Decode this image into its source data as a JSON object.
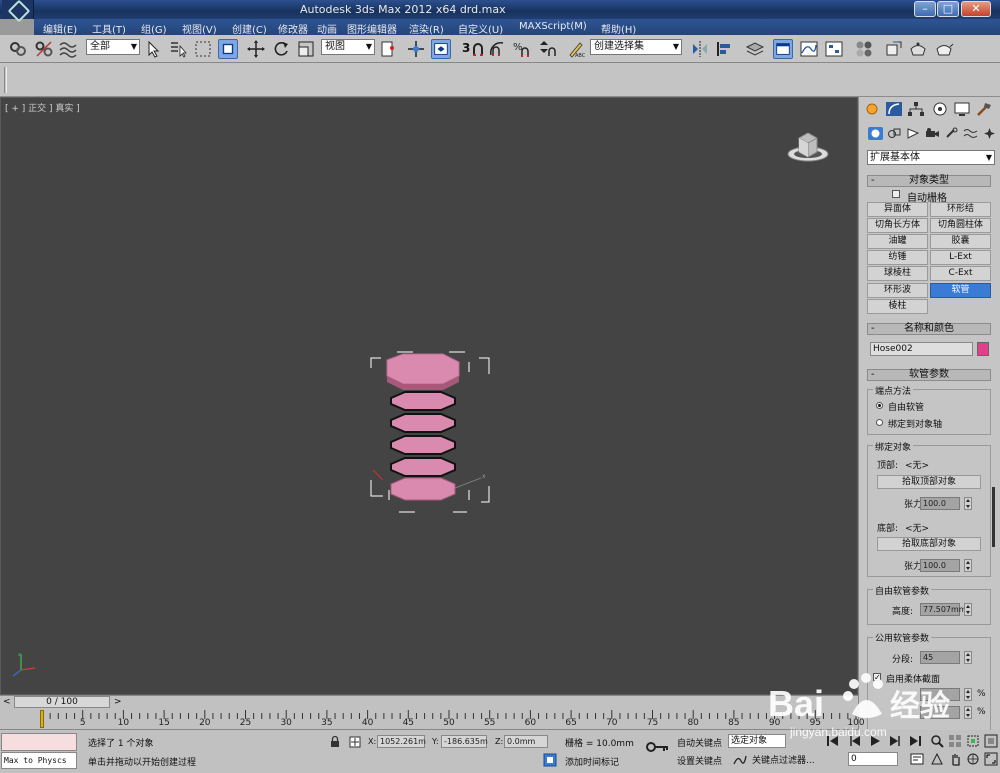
{
  "window": {
    "title": "Autodesk 3ds Max  2012 x64      drd.max",
    "minimize": "–",
    "maximize": "□",
    "close": "✕"
  },
  "menu": [
    "编辑(E)",
    "工具(T)",
    "组(G)",
    "视图(V)",
    "创建(C)",
    "修改器",
    "动画",
    "图形编辑器",
    "渲染(R)",
    "自定义(U)",
    "MAXScript(M)",
    "帮助(H)"
  ],
  "toolbar": {
    "filter_select": "全部",
    "coord_select": "视图",
    "snap_label": "3",
    "selection_set": "创建选择集"
  },
  "viewport": {
    "label": "[ + ] 正交 ] 真实 ]",
    "object_color": "#d98aae"
  },
  "command_panel": {
    "category": "扩展基本体",
    "object_type": {
      "title": "对象类型",
      "autogrid": "自动栅格",
      "buttons": [
        "异面体",
        "环形结",
        "切角长方体",
        "切角圆柱体",
        "油罐",
        "胶囊",
        "纺锤",
        "L-Ext",
        "球棱柱",
        "C-Ext",
        "环形波",
        "软管",
        "棱柱"
      ],
      "selected": "软管"
    },
    "name_color": {
      "title": "名称和颜色",
      "name": "Hose002",
      "color": "#e0418a"
    },
    "hose_params": {
      "title": "软管参数",
      "end_point_method": "端点方法",
      "free_hose": "自由软管",
      "bound_to_pivots": "绑定到对象轴",
      "binding_objects": "绑定对象",
      "top_label": "顶部:",
      "top_value": "<无>",
      "pick_top": "拾取顶部对象",
      "tension_label": "张力:",
      "tension_top": "100.0",
      "bottom_label": "底部:",
      "bottom_value": "<无>",
      "pick_bottom": "拾取底部对象",
      "tension_bottom": "100.0",
      "free_hose_params": "自由软管参数",
      "height_label": "高度:",
      "height_value": "77.507mm",
      "common_params": "公用软管参数",
      "segments_label": "分段:",
      "segments_value": "45",
      "flex_section": "启用柔体截面",
      "percent": "%"
    }
  },
  "timeline": {
    "slider": "0 / 100",
    "ticks": [
      "0",
      "5",
      "10",
      "15",
      "20",
      "25",
      "30",
      "35",
      "40",
      "45",
      "50",
      "55",
      "60",
      "65",
      "70",
      "75",
      "80",
      "85",
      "90",
      "95",
      "100"
    ]
  },
  "status": {
    "maxscript_line": "Max to Physcs",
    "selected": "选择了 1 个对象",
    "prompt": "单击并拖动以开始创建过程",
    "x_label": "X:",
    "x_value": "1052.261m",
    "y_label": "Y:",
    "y_value": "-186.635m",
    "z_label": "Z:",
    "z_value": "0.0mm",
    "grid": "栅格 = 10.0mm",
    "add_time_tag": "添加时间标记",
    "auto_key": "自动关键点",
    "set_key": "设置关键点",
    "selected_dropdown": "选定对象",
    "key_filters": "关键点过滤器...",
    "frame": "0"
  }
}
